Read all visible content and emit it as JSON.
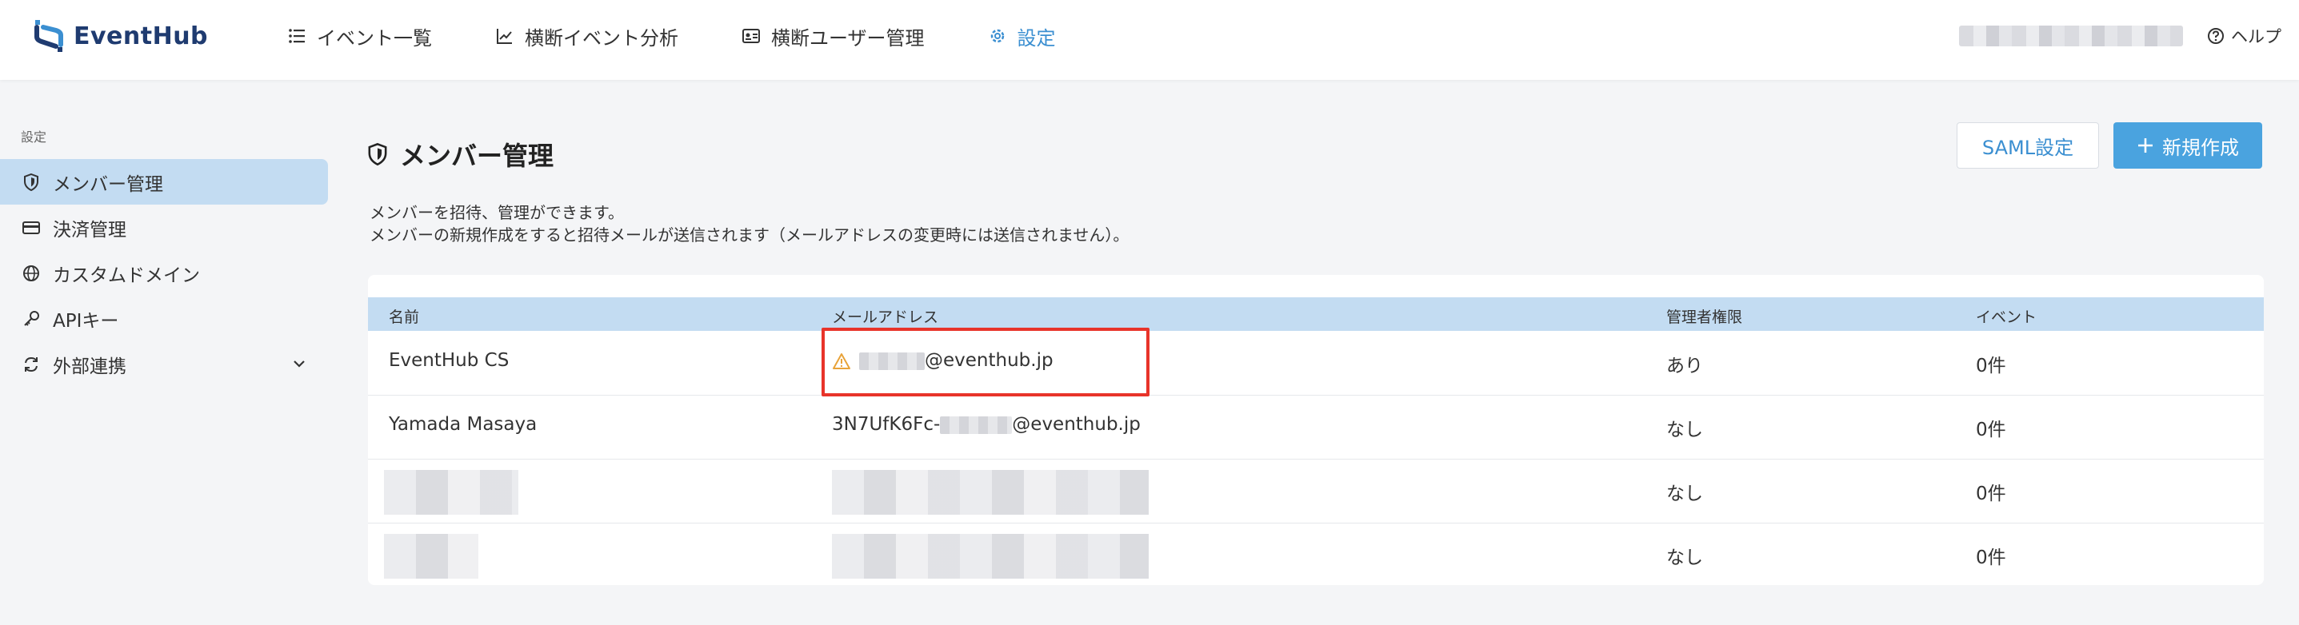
{
  "header": {
    "brand": "EventHub",
    "nav": [
      {
        "label": "イベント一覧",
        "icon": "list-icon"
      },
      {
        "label": "横断イベント分析",
        "icon": "line-chart-icon"
      },
      {
        "label": "横断ユーザー管理",
        "icon": "id-card-icon"
      },
      {
        "label": "設定",
        "icon": "gear-icon",
        "active": true
      }
    ],
    "help_label": "ヘルプ"
  },
  "sidebar": {
    "section_title": "設定",
    "items": [
      {
        "label": "メンバー管理",
        "icon": "shield-icon",
        "active": true
      },
      {
        "label": "決済管理",
        "icon": "credit-card-icon"
      },
      {
        "label": "カスタムドメイン",
        "icon": "globe-icon"
      },
      {
        "label": "APIキー",
        "icon": "key-icon"
      },
      {
        "label": "外部連携",
        "icon": "sync-icon"
      }
    ]
  },
  "main": {
    "title": "メンバー管理",
    "description_1": "メンバーを招待、管理ができます。",
    "description_2": "メンバーの新規作成をすると招待メールが送信されます（メールアドレスの変更時には送信されません）。",
    "saml_button": "SAML設定",
    "new_button": "新規作成"
  },
  "table": {
    "columns": [
      "名前",
      "メールアドレス",
      "管理者権限",
      "イベント"
    ],
    "rows": [
      {
        "name": "EventHub CS",
        "email_domain": "@eventhub.jp",
        "admin": "あり",
        "events": "0件"
      },
      {
        "name": "Yamada Masaya",
        "email_prefix": "3N7UfK6Fc-",
        "email_domain": "@eventhub.jp",
        "admin": "なし",
        "events": "0件"
      },
      {
        "name": "",
        "email": "",
        "admin": "なし",
        "events": "0件"
      },
      {
        "name": "",
        "email": "",
        "admin": "なし",
        "events": "0件"
      }
    ]
  },
  "colors": {
    "accent": "#3b8fd1",
    "primary_button": "#4aa3df",
    "active_bg": "#c3dcf2",
    "highlight": "#e8342a",
    "warning": "#e8a33a"
  }
}
